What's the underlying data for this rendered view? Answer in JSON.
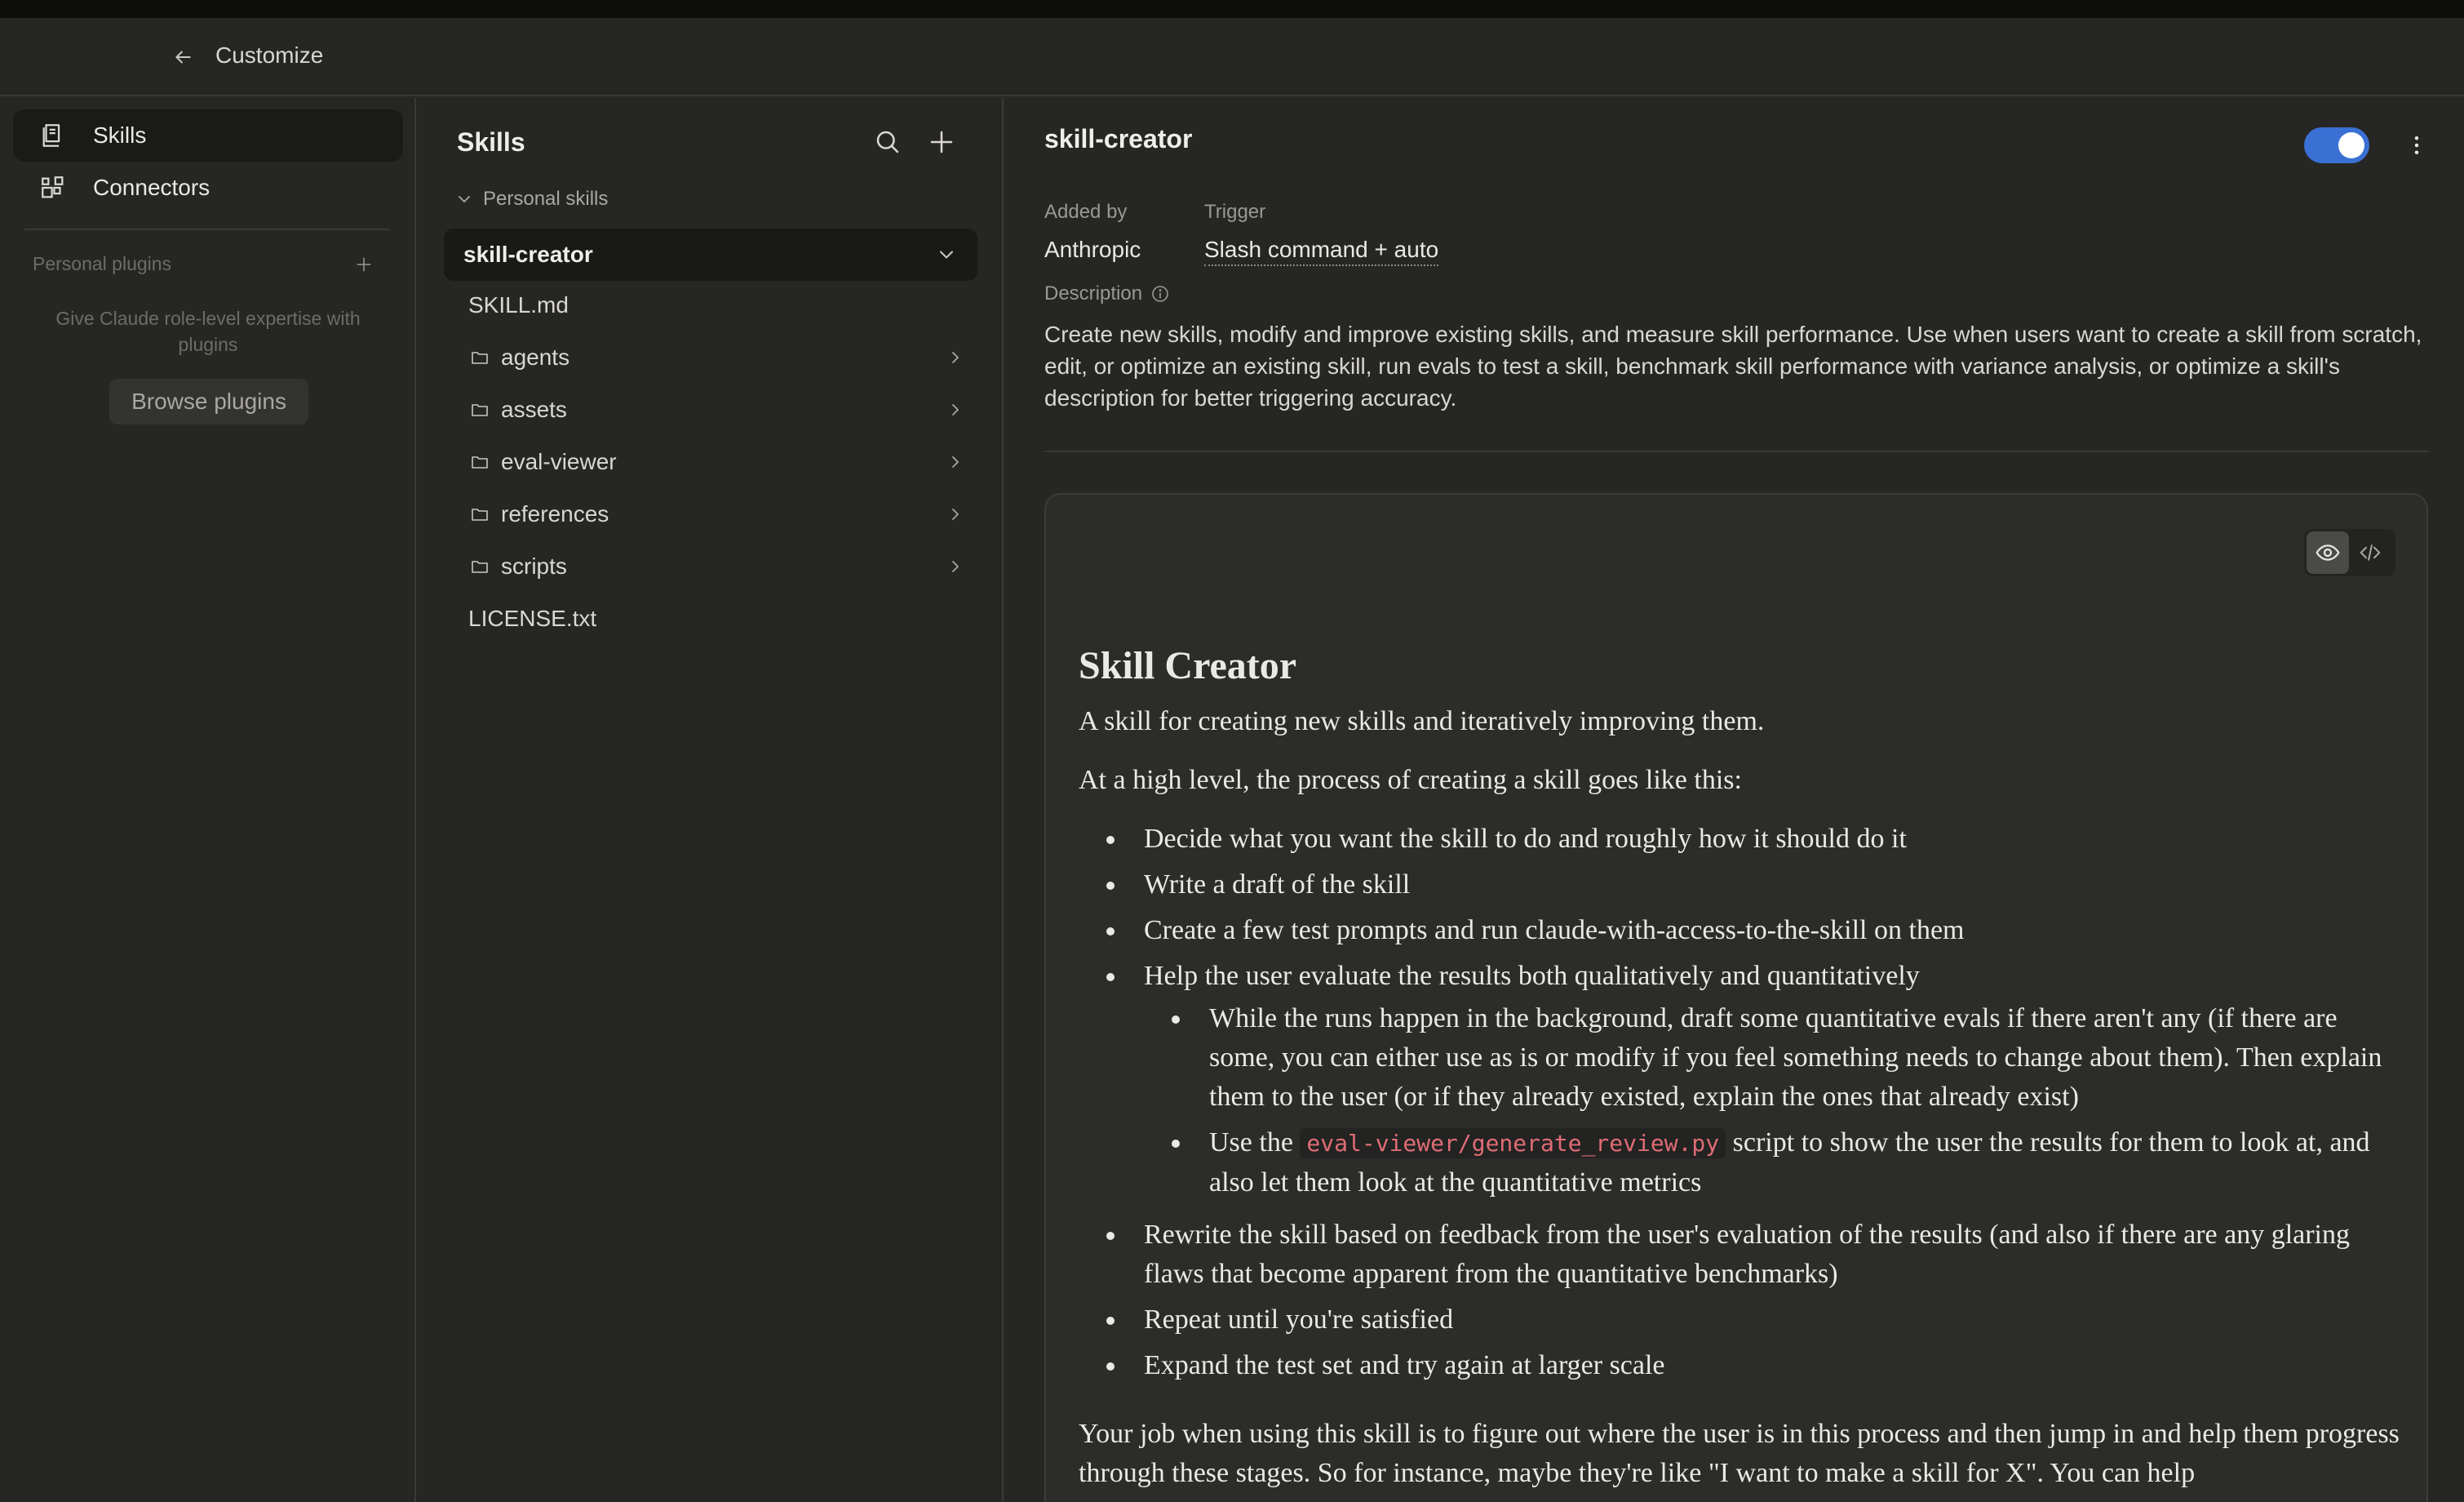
{
  "header": {
    "title": "Customize"
  },
  "sidebar": {
    "nav": [
      {
        "label": "Skills"
      },
      {
        "label": "Connectors"
      }
    ],
    "plugins": {
      "title": "Personal plugins",
      "empty_text": "Give Claude role-level expertise with plugins",
      "browse_label": "Browse plugins"
    }
  },
  "skills_panel": {
    "title": "Skills",
    "section_label": "Personal skills",
    "selected_skill": "skill-creator",
    "files": [
      {
        "name": "SKILL.md",
        "type": "file"
      },
      {
        "name": "agents",
        "type": "folder"
      },
      {
        "name": "assets",
        "type": "folder"
      },
      {
        "name": "eval-viewer",
        "type": "folder"
      },
      {
        "name": "references",
        "type": "folder"
      },
      {
        "name": "scripts",
        "type": "folder"
      },
      {
        "name": "LICENSE.txt",
        "type": "file"
      }
    ]
  },
  "detail": {
    "title": "skill-creator",
    "enabled": true,
    "added_by_label": "Added by",
    "added_by_value": "Anthropic",
    "trigger_label": "Trigger",
    "trigger_value": "Slash command + auto",
    "description_label": "Description",
    "description": "Create new skills, modify and improve existing skills, and measure skill performance. Use when users want to create a skill from scratch, edit, or optimize an existing skill, run evals to test a skill, benchmark skill performance with variance analysis, or optimize a skill's description for better triggering accuracy.",
    "doc": {
      "heading": "Skill Creator",
      "intro": "A skill for creating new skills and iteratively improving them.",
      "process_intro": "At a high level, the process of creating a skill goes like this:",
      "steps": [
        "Decide what you want the skill to do and roughly how it should do it",
        "Write a draft of the skill",
        "Create a few test prompts and run claude-with-access-to-the-skill on them",
        "Help the user evaluate the results both qualitatively and quantitatively"
      ],
      "substep_1": "While the runs happen in the background, draft some quantitative evals if there aren't any (if there are some, you can either use as is or modify if you feel something needs to change about them). Then explain them to the user (or if they already existed, explain the ones that already exist)",
      "substep_2_before": "Use the ",
      "substep_2_code": "eval-viewer/generate_review.py",
      "substep_2_after": " script to show the user the results for them to look at, and also let them look at the quantitative metrics",
      "steps_after": [
        "Rewrite the skill based on feedback from the user's evaluation of the results (and also if there are any glaring flaws that become apparent from the quantitative benchmarks)",
        "Repeat until you're satisfied",
        "Expand the test set and try again at larger scale"
      ],
      "closing": "Your job when using this skill is to figure out where the user is in this process and then jump in and help them progress through these stages. So for instance, maybe they're like \"I want to make a skill for X\". You can help"
    }
  },
  "colors": {
    "accent": "#3a70d4",
    "background": "#262624",
    "code": "#e06c75"
  }
}
